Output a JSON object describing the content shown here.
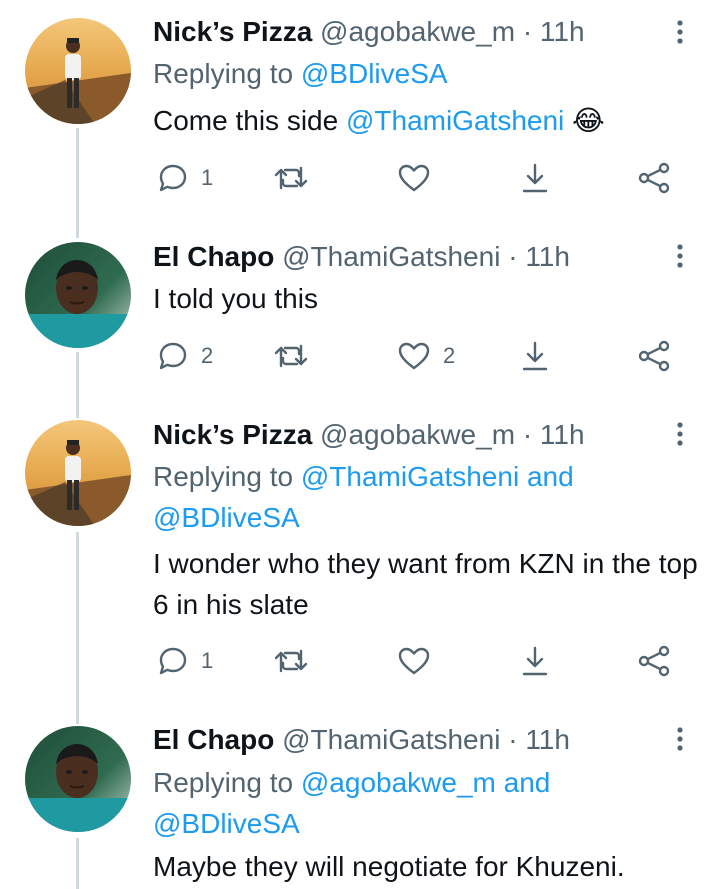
{
  "tweets": [
    {
      "name": "Nick’s Pizza",
      "handle": "@agobakwe_m",
      "dot": "·",
      "time": "11h",
      "replying_prefix": "Replying to ",
      "replying_to": [
        "@BDliveSA"
      ],
      "joiner": "",
      "body_prefix": "Come this side ",
      "body_mention": "@ThamiGatsheni",
      "body_emoji": "😂",
      "reply_count": "1",
      "retweet_count": "",
      "like_count": ""
    },
    {
      "name": "El Chapo",
      "handle": "@ThamiGatsheni",
      "dot": "·",
      "time": "11h",
      "body": "I told you this",
      "reply_count": "2",
      "retweet_count": "",
      "like_count": "2"
    },
    {
      "name": "Nick’s Pizza",
      "handle": "@agobakwe_m",
      "dot": "·",
      "time": "11h",
      "replying_prefix": "Replying to ",
      "replying_to": [
        "@ThamiGatsheni",
        "@BDliveSA"
      ],
      "joiner": " and",
      "body": "I wonder who they want from KZN in the top 6 in his slate",
      "reply_count": "1",
      "retweet_count": "",
      "like_count": ""
    },
    {
      "name": "El Chapo",
      "handle": "@ThamiGatsheni",
      "dot": "·",
      "time": "11h",
      "replying_prefix": "Replying to ",
      "replying_to": [
        "@agobakwe_m",
        "@BDliveSA"
      ],
      "joiner": " and",
      "body": "Maybe they will negotiate for Khuzeni."
    }
  ],
  "icons": {
    "reply": "reply-icon",
    "retweet": "retweet-icon",
    "like": "like-icon",
    "bookmark": "download-icon",
    "share": "share-icon",
    "more": "more-icon"
  },
  "colors": {
    "link": "#1d9bf0",
    "secondary": "#536471",
    "text": "#0f1419",
    "thread_line": "#cfd9de"
  }
}
